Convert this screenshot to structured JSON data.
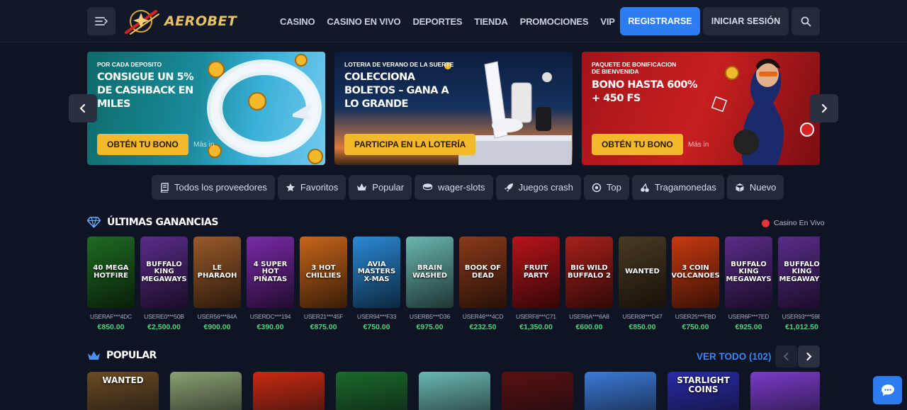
{
  "header": {
    "logo_text": "AEROBET",
    "nav": [
      "CASINO",
      "CASINO EN VIVO",
      "DEPORTES",
      "TIENDA",
      "PROMOCIONES",
      "VIP"
    ],
    "register_label": "REGISTRARSE",
    "login_label": "INICIAR SESIÓN"
  },
  "banners": [
    {
      "subtitle": "POR CADA DEPOSITO",
      "title": "CONSIGUE UN 5% DE CASHBACK EN MILES",
      "cta": "OBTÉN TU BONO",
      "more": "Más in"
    },
    {
      "subtitle": "LOTERIA DE VERANO DE LA SUERTE",
      "title": "COLECCIONA BOLETOS – GANA A LO GRANDE",
      "cta": "PARTICIPA EN LA LOTERÍA",
      "more": ""
    },
    {
      "subtitle": "PAQUETE DE BONIFICACION DE BIENVENIDA",
      "title": "BONO HASTA 600% + 450 FS",
      "cta": "OBTÉN TU BONO",
      "more": "Más in"
    }
  ],
  "filters": [
    {
      "label": "Todos los proveedores",
      "icon": "book-icon"
    },
    {
      "label": "Favoritos",
      "icon": "star-icon"
    },
    {
      "label": "Popular",
      "icon": "crown-icon"
    },
    {
      "label": "wager-slots",
      "icon": "coins-icon"
    },
    {
      "label": "Juegos crash",
      "icon": "rocket-icon"
    },
    {
      "label": "Top",
      "icon": "badge-icon"
    },
    {
      "label": "Tragamonedas",
      "icon": "cherry-icon"
    },
    {
      "label": "Nuevo",
      "icon": "cube-icon"
    }
  ],
  "latest_wins": {
    "title": "ÚLTIMAS GANANCIAS",
    "live_label": "Casino En Vivo",
    "items": [
      {
        "game": "40 MEGA HOTFIRE",
        "user": "USERAF***4DC",
        "amount": "€850.00",
        "color": "#1f6b22"
      },
      {
        "game": "BUFFALO KING MEGAWAYS",
        "user": "USERE0***50B",
        "amount": "€2,500.00",
        "color": "#5a2c8a"
      },
      {
        "game": "LE PHARAOH",
        "user": "USER56***84A",
        "amount": "€900.00",
        "color": "#9a5a2a"
      },
      {
        "game": "4 SUPER HOT PIÑATAS",
        "user": "USERDC***194",
        "amount": "€390.00",
        "color": "#7a2aa8"
      },
      {
        "game": "3 HOT CHILLIES",
        "user": "USER21***45F",
        "amount": "€875.00",
        "color": "#c8651a"
      },
      {
        "game": "AVIA MASTERS X-MAS",
        "user": "USER94***F33",
        "amount": "€750.00",
        "color": "#2a8ad8"
      },
      {
        "game": "BRAIN WASHED",
        "user": "USERB5***D36",
        "amount": "€975.00",
        "color": "#6ab8b0"
      },
      {
        "game": "BOOK OF DEAD",
        "user": "USER46***4CD",
        "amount": "€232.50",
        "color": "#8a3a1a"
      },
      {
        "game": "FRUIT PARTY",
        "user": "USERF8***C71",
        "amount": "€1,350.00",
        "color": "#b8141a"
      },
      {
        "game": "BIG WILD BUFFALO 2",
        "user": "USER6A***6A8",
        "amount": "€600.00",
        "color": "#a8201a"
      },
      {
        "game": "WANTED",
        "user": "USER08***D47",
        "amount": "€850.00",
        "color": "#4a3a22"
      },
      {
        "game": "3 COIN VOLCANOES",
        "user": "USER25***FBD",
        "amount": "€750.00",
        "color": "#c83a10"
      },
      {
        "game": "BUFFALO KING MEGAWAYS",
        "user": "USER6F***7ED",
        "amount": "€925.00",
        "color": "#5a2c8a"
      },
      {
        "game": "BUFFALO KING MEGAWAYS",
        "user": "USER93***59E",
        "amount": "€1,012.50",
        "color": "#5a2c8a"
      }
    ]
  },
  "popular": {
    "title": "POPULAR",
    "see_all": "VER TODO (102)",
    "items": [
      {
        "game": "WANTED",
        "color": "#6a4a22"
      },
      {
        "game": "",
        "color": "#8aa070"
      },
      {
        "game": "",
        "color": "#c82a10"
      },
      {
        "game": "",
        "color": "#1a6a2a"
      },
      {
        "game": "",
        "color": "#6ab8b0"
      },
      {
        "game": "",
        "color": "#5a1010"
      },
      {
        "game": "",
        "color": "#3a7ad8"
      },
      {
        "game": "STARLIGHT COINS",
        "color": "#2a2aa8"
      },
      {
        "game": "",
        "color": "#7a3ac8"
      }
    ]
  }
}
